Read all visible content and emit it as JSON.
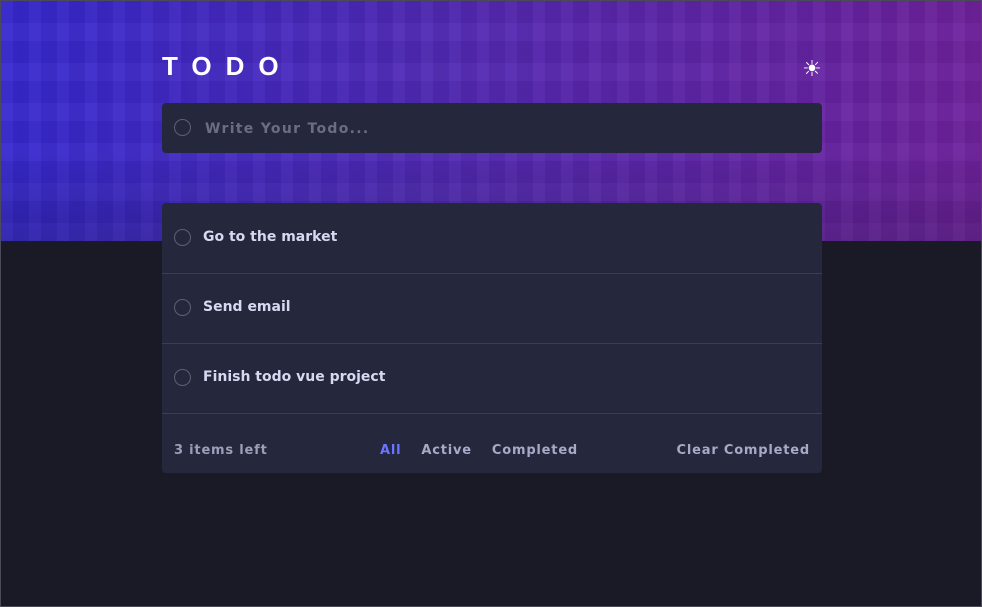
{
  "app": {
    "title": "TODO",
    "theme_icon": "sun-icon"
  },
  "input": {
    "placeholder": "Write Your Todo..."
  },
  "todos": [
    {
      "label": "Go to the market"
    },
    {
      "label": "Send email"
    },
    {
      "label": "Finish todo vue project"
    }
  ],
  "footer": {
    "items_left": "3 items left",
    "filters": [
      {
        "label": "All"
      },
      {
        "label": "Active"
      },
      {
        "label": "Completed"
      }
    ],
    "clear_label": "Clear Completed"
  },
  "colors": {
    "accent": "#6876ff",
    "card": "#25273c",
    "background": "#191a26",
    "text": "#d7d8f2",
    "muted": "#a7a9c7"
  }
}
